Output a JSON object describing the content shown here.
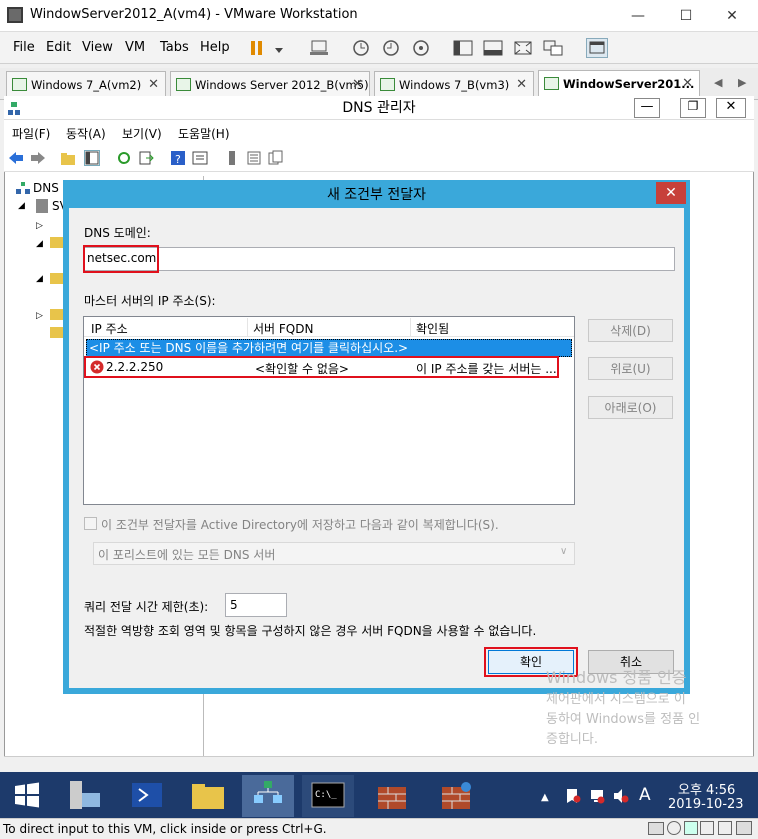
{
  "vm_window": {
    "title": "WindowServer2012_A(vm4) - VMware Workstation",
    "controls": [
      "—",
      "☐",
      "✕"
    ]
  },
  "vm_menu": {
    "items": [
      "File",
      "Edit",
      "View",
      "VM",
      "Tabs",
      "Help"
    ]
  },
  "vm_tabs": [
    {
      "label": "Windows 7_A(vm2)",
      "active": false
    },
    {
      "label": "Windows Server 2012_B(vm5)",
      "active": false
    },
    {
      "label": "Windows 7_B(vm3)",
      "active": false
    },
    {
      "label": "WindowServer201...",
      "active": true
    }
  ],
  "dns_manager": {
    "title": "DNS 관리자",
    "menu": [
      "파일(F)",
      "동작(A)",
      "보기(V)",
      "도움말(H)"
    ],
    "tree": {
      "root": "DNS",
      "server": "SV"
    }
  },
  "dialog": {
    "title": "새 조건부 전달자",
    "close": "✕",
    "dns_domain_label": "DNS 도메인:",
    "dns_domain_value": "netsec.com",
    "master_ip_label": "마스터 서버의 IP 주소(S):",
    "columns": [
      "IP 주소",
      "서버 FQDN",
      "확인됨"
    ],
    "hint_row": "<IP 주소 또는 DNS 이름을 추가하려면 여기를 클릭하십시오.>",
    "rows": [
      {
        "ip": "2.2.2.250",
        "fqdn": "<확인할 수 없음>",
        "verified": "이 IP 주소를 갖는 서버는 ..."
      }
    ],
    "buttons_side": {
      "delete": "삭제(D)",
      "up": "위로(U)",
      "down": "아래로(O)"
    },
    "ad_checkbox_label": "이 조건부 전달자를 Active Directory에 저장하고 다음과 같이 복제합니다(S).",
    "ad_scope_value": "이 포리스트에 있는 모든 DNS 서버",
    "timeout_label": "쿼리 전달 시간 제한(초):",
    "timeout_value": "5",
    "fqdn_note": "적절한 역방향 조회 영역 및 항목을 구성하지 않은 경우 서버 FQDN을 사용할 수 없습니다.",
    "ok": "확인",
    "cancel": "취소"
  },
  "watermark": {
    "line1": "Windows 정품 인증",
    "line2": "제어판에서 시스템으로 이",
    "line3": "동하여 Windows를 정품 인",
    "line4": "증합니다."
  },
  "taskbar": {
    "time": "오후 4:56",
    "date": "2019-10-23",
    "ime": "A"
  },
  "status": {
    "text": "To direct input to this VM, click inside or press Ctrl+G."
  },
  "colors": {
    "accent": "#3aa8da",
    "highlight_red": "#e0101c",
    "selection": "#1c8ee6",
    "taskbar": "#1d3a6b"
  }
}
